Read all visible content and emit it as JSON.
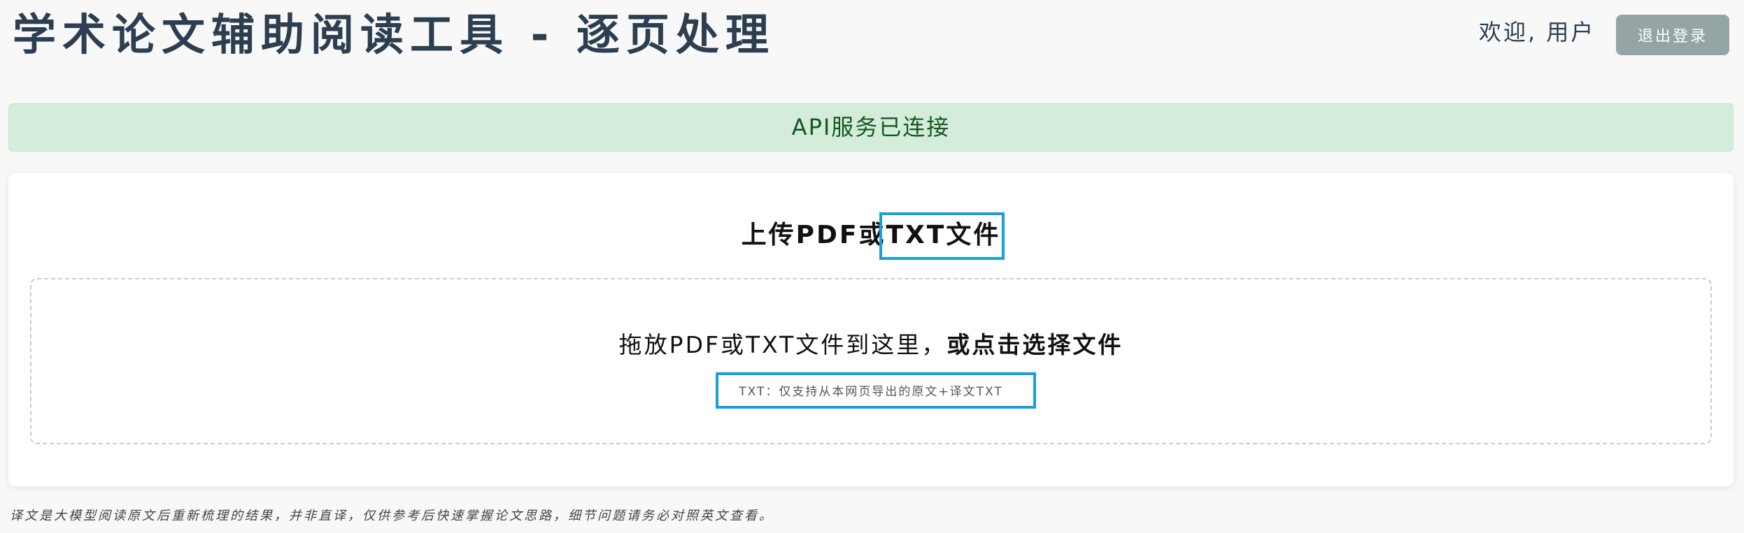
{
  "header": {
    "title": "学术论文辅助阅读工具 - 逐页处理",
    "welcome": "欢迎, 用户",
    "logout_label": "退出登录"
  },
  "status": {
    "message": "API服务已连接",
    "state": "connected"
  },
  "upload": {
    "title": "上传PDF或TXT文件",
    "drop_text_prefix": "拖放PDF或TXT文件到这里，",
    "drop_text_action": "或点击选择文件",
    "hint": "TXT：仅支持从本网页导出的原文+译文TXT"
  },
  "footer": {
    "note": "译文是大模型阅读原文后重新梳理的结果，并非直译，仅供参考后快速掌握论文思路，细节问题请务必对照英文查看。"
  },
  "colors": {
    "background": "#f8f8f8",
    "title": "#2c3e50",
    "logout_button": "#95a5a6",
    "status_bg": "#d4edda",
    "status_text": "#155724",
    "highlight": "#1a9fd9"
  }
}
